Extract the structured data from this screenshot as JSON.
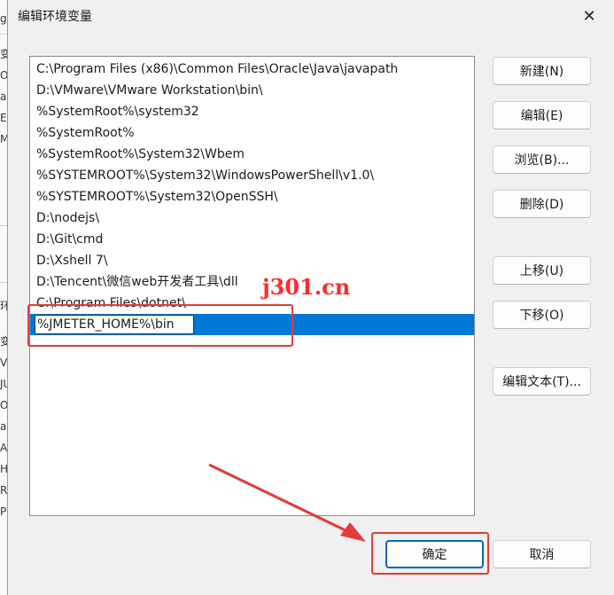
{
  "dialog": {
    "title": "编辑环境变量",
    "close_glyph": "✕"
  },
  "path_list": {
    "items": [
      "C:\\Program Files (x86)\\Common Files\\Oracle\\Java\\javapath",
      "D:\\VMware\\VMware Workstation\\bin\\",
      "%SystemRoot%\\system32",
      "%SystemRoot%",
      "%SystemRoot%\\System32\\Wbem",
      "%SYSTEMROOT%\\System32\\WindowsPowerShell\\v1.0\\",
      "%SYSTEMROOT%\\System32\\OpenSSH\\",
      "D:\\nodejs\\",
      "D:\\Git\\cmd",
      "D:\\Xshell 7\\",
      "D:\\Tencent\\微信web开发者工具\\dll",
      "C:\\Program Files\\dotnet\\"
    ],
    "editing_value": "%JMETER_HOME%\\bin"
  },
  "watermark": "j301.cn",
  "buttons": {
    "new": "新建(N)",
    "edit": "编辑(E)",
    "browse": "浏览(B)...",
    "delete": "删除(D)",
    "move_up": "上移(U)",
    "move_down": "下移(O)",
    "edit_text": "编辑文本(T)...",
    "ok": "确定",
    "cancel": "取消"
  },
  "background_window": {
    "chars": [
      "g",
      "变",
      "Or",
      "a",
      "E",
      "M",
      "环",
      "变",
      "V",
      "JU",
      "OS",
      "a",
      "A",
      "H",
      "R",
      "P"
    ]
  },
  "colors": {
    "selection": "#0078d7",
    "annotation": "#e23b3b",
    "primary_border": "#0067c0"
  }
}
